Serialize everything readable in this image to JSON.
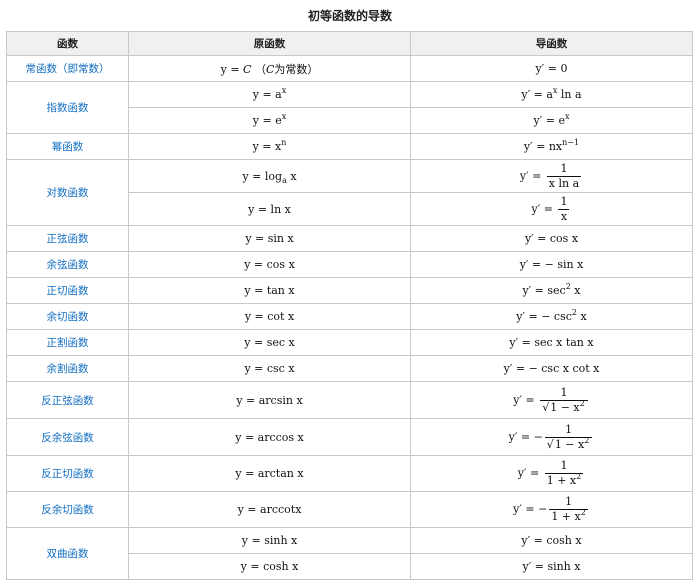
{
  "caption": "初等函数的导数",
  "headers": [
    "函数",
    "原函数",
    "导函数"
  ],
  "groups": [
    {
      "name": "常函数（即常数）",
      "rows": [
        {
          "orig": [
            "y = ",
            "C",
            " （",
            "C",
            "为常数）"
          ],
          "deriv": [
            "y′ = 0"
          ]
        }
      ]
    },
    {
      "name": "指数函数",
      "rows": [
        {
          "orig": [
            "y = a",
            "x"
          ],
          "deriv": [
            "y′ = a",
            "x",
            " ln a"
          ]
        },
        {
          "orig": [
            "y = e",
            "x"
          ],
          "deriv": [
            "y′ = e",
            "x"
          ]
        }
      ]
    },
    {
      "name": "幂函数",
      "rows": [
        {
          "orig": [
            "y = x",
            "n"
          ],
          "deriv": [
            "y′ = nx",
            "n−1"
          ]
        }
      ]
    },
    {
      "name": "对数函数",
      "rows": [
        {
          "orig": [
            "y = log",
            "a",
            " x"
          ],
          "deriv": [
            "y′ = ",
            "1",
            "x ln a"
          ]
        },
        {
          "orig": [
            "y = ln x"
          ],
          "deriv": [
            "y′ = ",
            "1",
            "x"
          ]
        }
      ]
    },
    {
      "name": "正弦函数",
      "rows": [
        {
          "orig": [
            "y = sin x"
          ],
          "deriv": [
            "y′ = cos x"
          ]
        }
      ]
    },
    {
      "name": "余弦函数",
      "rows": [
        {
          "orig": [
            "y = cos x"
          ],
          "deriv": [
            "y′ = − sin x"
          ]
        }
      ]
    },
    {
      "name": "正切函数",
      "rows": [
        {
          "orig": [
            "y = tan x"
          ],
          "deriv": [
            "y′ = sec",
            "2",
            " x"
          ]
        }
      ]
    },
    {
      "name": "余切函数",
      "rows": [
        {
          "orig": [
            "y = cot x"
          ],
          "deriv": [
            "y′ = − csc",
            "2",
            " x"
          ]
        }
      ]
    },
    {
      "name": "正割函数",
      "rows": [
        {
          "orig": [
            "y = sec x"
          ],
          "deriv": [
            "y′ = sec x tan x"
          ]
        }
      ]
    },
    {
      "name": "余割函数",
      "rows": [
        {
          "orig": [
            "y = csc x"
          ],
          "deriv": [
            "y′ = − csc x cot x"
          ]
        }
      ]
    },
    {
      "name": "反正弦函数",
      "rows": [
        {
          "orig": [
            "y = arcsin x"
          ],
          "deriv": [
            "y′ = ",
            "1",
            "√",
            "1 − x",
            "2"
          ]
        }
      ]
    },
    {
      "name": "反余弦函数",
      "rows": [
        {
          "orig": [
            "y = arccos x"
          ],
          "deriv": [
            "y′ = −",
            "1",
            "√",
            "1 − x",
            "2"
          ]
        }
      ]
    },
    {
      "name": "反正切函数",
      "rows": [
        {
          "orig": [
            "y = arctan x"
          ],
          "deriv": [
            "y′ = ",
            "1",
            "1 + x",
            "2"
          ]
        }
      ]
    },
    {
      "name": "反余切函数",
      "rows": [
        {
          "orig": [
            "y = arccotx"
          ],
          "deriv": [
            "y′ = −",
            "1",
            "1 + x",
            "2"
          ]
        }
      ]
    },
    {
      "name": "双曲函数",
      "rows": [
        {
          "orig": [
            "y = sinh x"
          ],
          "deriv": [
            "y′ = cosh x"
          ]
        },
        {
          "orig": [
            "y = cosh x"
          ],
          "deriv": [
            "y′ = sinh x"
          ]
        }
      ]
    }
  ]
}
